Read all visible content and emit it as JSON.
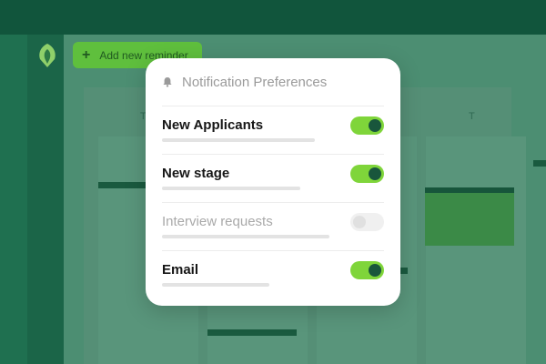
{
  "app": {
    "add_button_label": "Add new reminder",
    "calendar_col_labels": [
      "T",
      "T"
    ]
  },
  "modal": {
    "title": "Notification Preferences",
    "icon": "bell-icon",
    "items": [
      {
        "label": "New Applicants",
        "enabled": true
      },
      {
        "label": "New stage",
        "enabled": true
      },
      {
        "label": "Interview requests",
        "enabled": false
      },
      {
        "label": "Email",
        "enabled": true
      }
    ]
  },
  "colors": {
    "toggle_on": "#7fd53a",
    "toggle_knob": "#19563c",
    "brand_dark": "#11553c"
  }
}
